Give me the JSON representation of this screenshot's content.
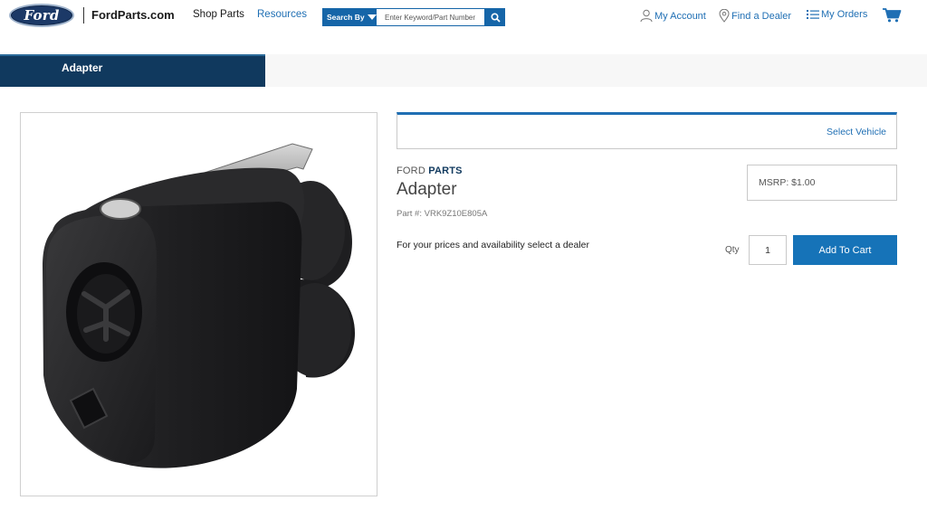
{
  "header": {
    "logo_text": "Ford",
    "site_name": "FordParts.com",
    "nav": {
      "shop_parts": "Shop Parts",
      "resources": "Resources"
    },
    "search": {
      "search_by_label": "Search By",
      "placeholder": "Enter Keyword/Part Number"
    },
    "links": {
      "my_account": "My Account",
      "find_dealer": "Find a Dealer",
      "my_orders": "My Orders"
    },
    "icons": {
      "search": "search-icon",
      "account": "user-icon",
      "dealer": "location-pin-icon",
      "orders": "list-icon",
      "cart": "cart-icon"
    }
  },
  "title_bar": {
    "title": "Adapter"
  },
  "product": {
    "image": "adapter-product-image",
    "vehicle_selector": "Select Vehicle",
    "brand_prefix": "FORD",
    "brand_suffix": "PARTS",
    "name": "Adapter",
    "part_number": "Part #: VRK9Z10E805A",
    "msrp": "MSRP: $1.00",
    "dealer_message": "For your prices and availability select a dealer",
    "qty_label": "Qty",
    "qty_value": "1",
    "add_to_cart": "Add To Cart"
  },
  "colors": {
    "brand_navy": "#10395e",
    "link_blue": "#1f6fb4",
    "button_blue": "#1673b8"
  }
}
